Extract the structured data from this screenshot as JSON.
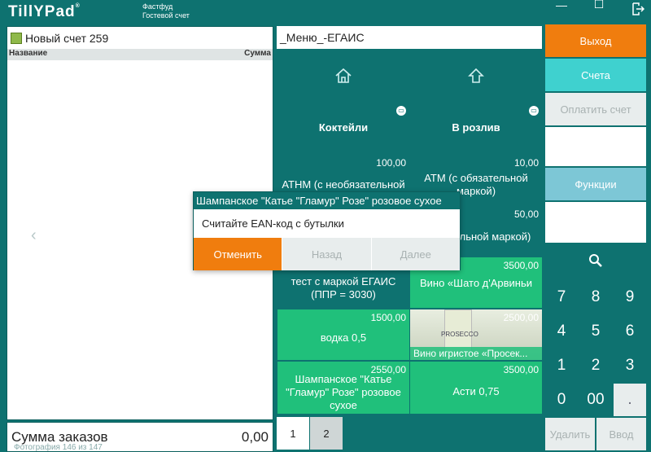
{
  "header": {
    "logo": "TillYPad",
    "mode": "Фастфуд",
    "account_type": "Гостевой счет"
  },
  "window": {
    "minimize": "—",
    "restore": "☐",
    "logout_icon": "logout-icon"
  },
  "order": {
    "title": "Новый счет 259",
    "col_name": "Название",
    "col_sum": "Сумма",
    "total_label": "Сумма заказов",
    "total_value": "0,00"
  },
  "photo_caption": "Фотография 146 из 147",
  "menu": {
    "title": "_Меню_-ЕГАИС",
    "tiles": [
      {
        "label": "",
        "price": ""
      },
      {
        "label": "",
        "price": ""
      },
      {
        "label": "Коктейли",
        "price": ""
      },
      {
        "label": "В розлив",
        "price": ""
      },
      {
        "label": "АТНМ (с необязательной",
        "price": "100,00"
      },
      {
        "label": "АТМ (с обязательной маркой)",
        "price": "10,00"
      },
      {
        "label": "",
        "price": ""
      },
      {
        "label": "обязательной маркой)",
        "price": "50,00"
      },
      {
        "label": "тест с маркой ЕГАИС (ППР = 3030)",
        "price": ""
      },
      {
        "label": "Вино «Шато д'Арвиньи",
        "price": "3500,00"
      },
      {
        "label": "водка 0,5",
        "price": "1500,00"
      },
      {
        "label": "Вино игристое «Просек...",
        "price": "2500,00"
      },
      {
        "label": "Шампанское \"Катье \"Гламур\" Розе\" розовое сухое",
        "price": "2550,00"
      },
      {
        "label": "Асти 0,75",
        "price": "3500,00"
      }
    ],
    "wine_label": "PROSECCO",
    "pages": [
      "1",
      "2"
    ]
  },
  "right_panel": {
    "exit": "Выход",
    "accounts": "Счета",
    "pay": "Оплатить счет",
    "functions": "Функции",
    "keys": [
      "7",
      "8",
      "9",
      "4",
      "5",
      "6",
      "1",
      "2",
      "3",
      "0",
      "00",
      "."
    ],
    "delete": "Удалить",
    "enter": "Ввод"
  },
  "dialog": {
    "title": "Шампанское \"Катье \"Гламур\" Розе\" розовое сухое",
    "message": "Считайте EAN-код с бутылки",
    "cancel": "Отменить",
    "back": "Назад",
    "next": "Далее"
  },
  "colors": {
    "teal": "#0e7270",
    "green": "#20c07b",
    "orange": "#f07d0e",
    "cyan": "#3fd1cf",
    "light_blue": "#7dc7d6"
  }
}
